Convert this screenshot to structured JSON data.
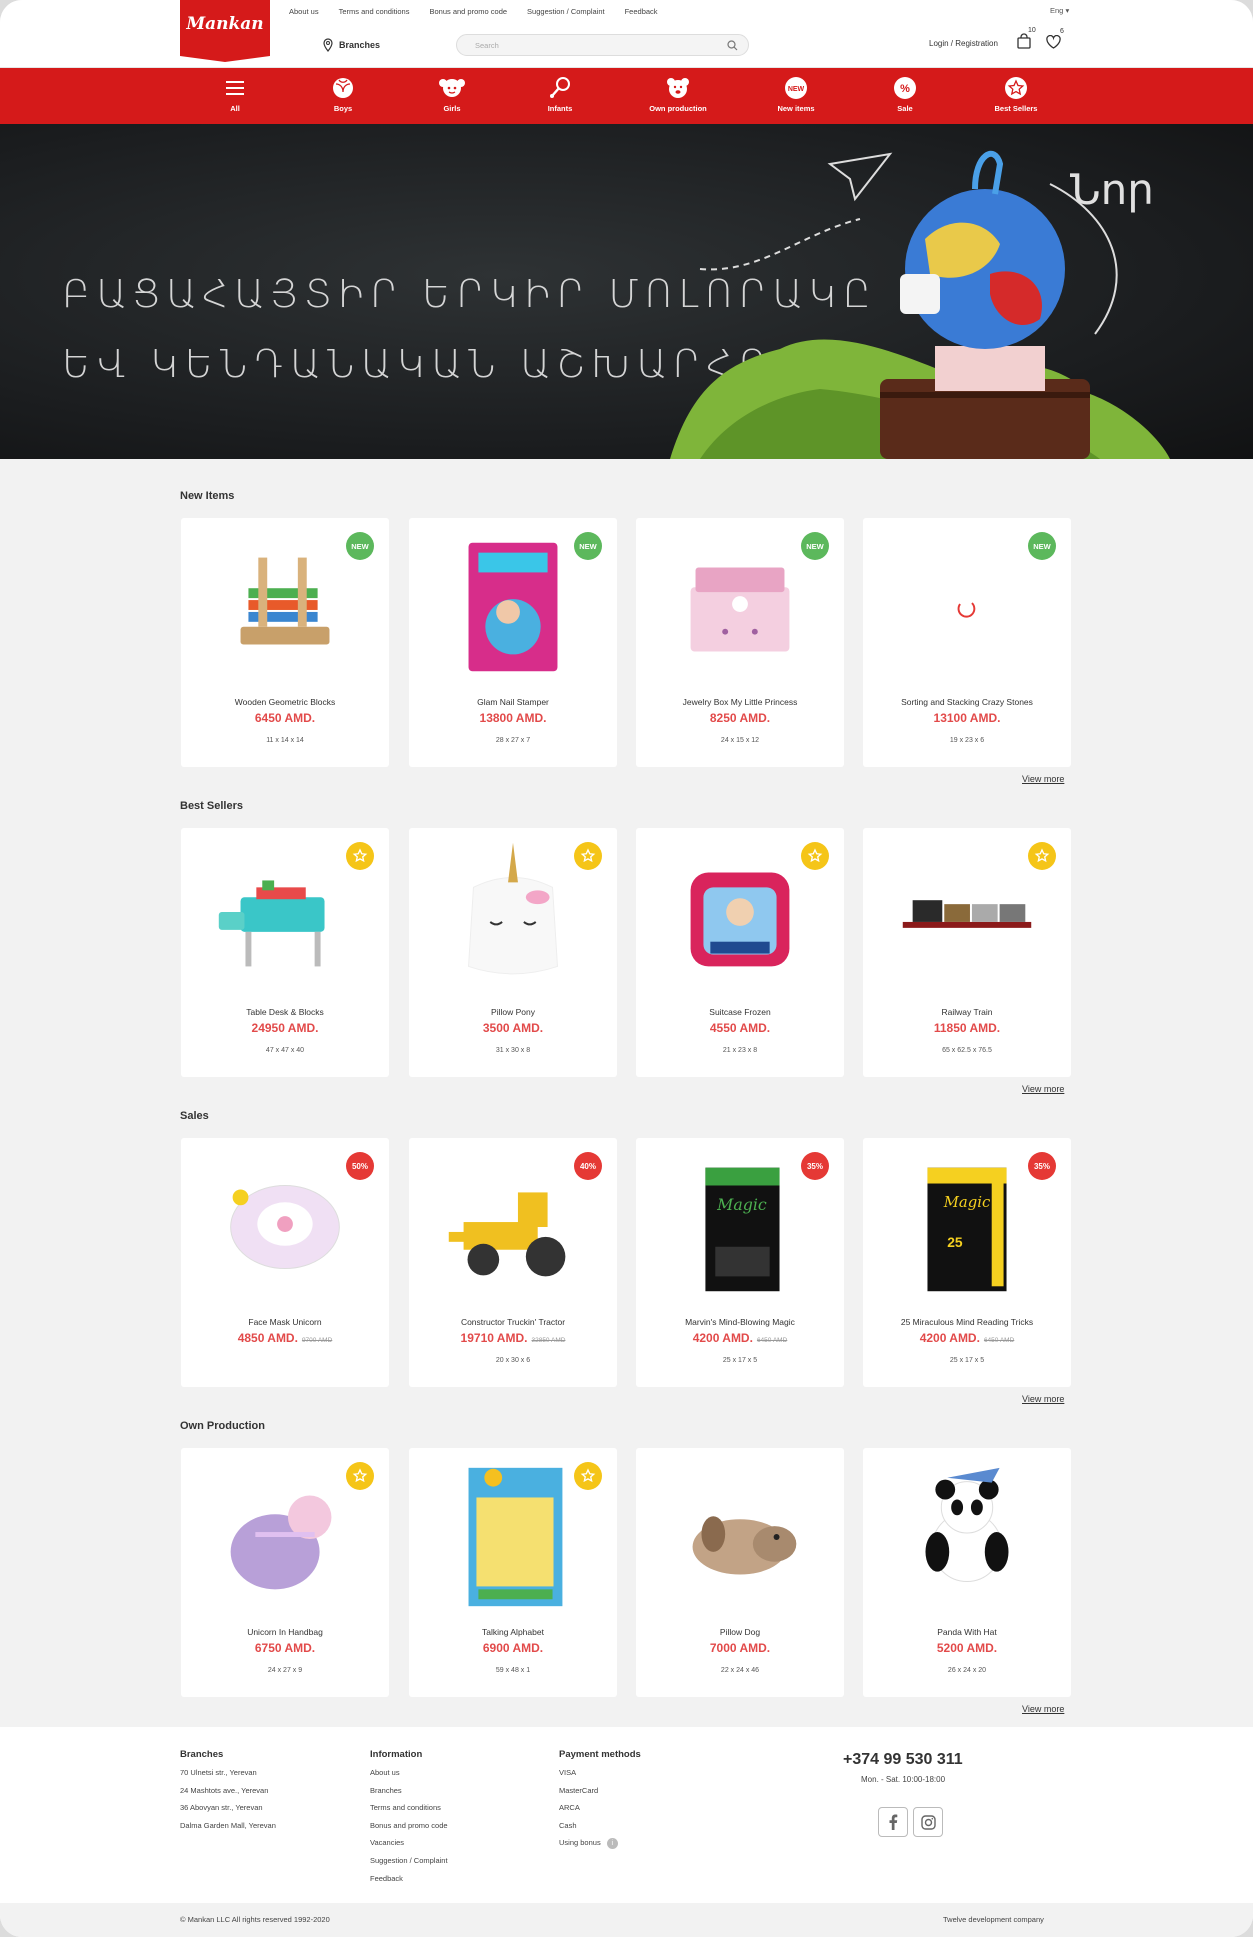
{
  "header": {
    "logo_text": "Mankan",
    "top_links": [
      "About us",
      "Terms and conditions",
      "Bonus and promo code",
      "Suggestion / Complaint",
      "Feedback"
    ],
    "language": "Eng",
    "branches_label": "Branches",
    "search_placeholder": "Search",
    "login_label": "Login / Registration",
    "cart_count": "10",
    "favorites_count": "6"
  },
  "nav": {
    "items": [
      {
        "label": "All",
        "icon": "menu-icon"
      },
      {
        "label": "Boys",
        "icon": "ball-icon"
      },
      {
        "label": "Girls",
        "icon": "doll-icon"
      },
      {
        "label": "Infants",
        "icon": "rattle-icon"
      },
      {
        "label": "Own production",
        "icon": "bear-icon"
      },
      {
        "label": "New items",
        "icon": "new-icon"
      },
      {
        "label": "Sale",
        "icon": "percent-icon"
      },
      {
        "label": "Best Sellers",
        "icon": "star-icon"
      }
    ],
    "accent": "#d51a1a"
  },
  "hero": {
    "line1": "ԲԱՑԱՀԱՅՏԻՐ ԵՐԿԻՐ ՄՈԼՈՐԱԿԸ",
    "line2": "ԵՎ ԿԵՆԴԱՆԱԿԱՆ ԱՇԽԱՐՀԸ",
    "scribble": "Նոր"
  },
  "sections": [
    {
      "title": "New Items",
      "view_more": "View more",
      "badge_type": "new",
      "products": [
        {
          "name": "Wooden Geometric Blocks",
          "price": "6450 AMD.",
          "old_price": "",
          "dims": "11 x 14 x 14",
          "badge": "NEW"
        },
        {
          "name": "Glam Nail Stamper",
          "price": "13800 AMD.",
          "old_price": "",
          "dims": "28 x 27 x 7",
          "badge": "NEW"
        },
        {
          "name": "Jewelry Box My Little Princess",
          "price": "8250 AMD.",
          "old_price": "",
          "dims": "24 x 15 x 12",
          "badge": "NEW"
        },
        {
          "name": "Sorting and Stacking Crazy Stones",
          "price": "13100 AMD.",
          "old_price": "",
          "dims": "19 x 23 x 6",
          "badge": "NEW"
        }
      ]
    },
    {
      "title": "Best Sellers",
      "view_more": "View more",
      "badge_type": "star",
      "products": [
        {
          "name": "Table Desk & Blocks",
          "price": "24950 AMD.",
          "old_price": "",
          "dims": "47 x 47 x 40",
          "badge": ""
        },
        {
          "name": "Pillow Pony",
          "price": "3500 AMD.",
          "old_price": "",
          "dims": "31 x 30 x 8",
          "badge": ""
        },
        {
          "name": "Suitcase Frozen",
          "price": "4550 AMD.",
          "old_price": "",
          "dims": "21 x 23 x 8",
          "badge": ""
        },
        {
          "name": "Railway Train",
          "price": "11850 AMD.",
          "old_price": "",
          "dims": "65 x 62.5 x 76.5",
          "badge": ""
        }
      ]
    },
    {
      "title": "Sales",
      "view_more": "View more",
      "badge_type": "sale",
      "products": [
        {
          "name": "Face Mask Unicorn",
          "price": "4850 AMD.",
          "old_price": "9700 AMD",
          "dims": "",
          "badge": "50%"
        },
        {
          "name": "Constructor Truckin' Tractor",
          "price": "19710 AMD.",
          "old_price": "32850 AMD",
          "dims": "20 x 30 x 6",
          "badge": "40%"
        },
        {
          "name": "Marvin's Mind-Blowing Magic",
          "price": "4200 AMD.",
          "old_price": "6450 AMD",
          "dims": "25 x 17 x 5",
          "badge": "35%"
        },
        {
          "name": "25 Miraculous Mind Reading Tricks",
          "price": "4200 AMD.",
          "old_price": "6450 AMD",
          "dims": "25 x 17 x 5",
          "badge": "35%"
        }
      ]
    },
    {
      "title": "Own Production",
      "view_more": "View more",
      "badge_type": "star",
      "products": [
        {
          "name": "Unicorn In Handbag",
          "price": "6750 AMD.",
          "old_price": "",
          "dims": "24 x 27 x 9",
          "badge": ""
        },
        {
          "name": "Talking Alphabet",
          "price": "6900 AMD.",
          "old_price": "",
          "dims": "59 x 48 x 1",
          "badge": ""
        },
        {
          "name": "Pillow Dog",
          "price": "7000 AMD.",
          "old_price": "",
          "dims": "22 x 24 x 46",
          "badge": ""
        },
        {
          "name": "Panda With Hat",
          "price": "5200 AMD.",
          "old_price": "",
          "dims": "26 x 24 x 20",
          "badge": ""
        }
      ]
    }
  ],
  "footer": {
    "branches": {
      "title": "Branches",
      "items": [
        "70 Ulnetsi str., Yerevan",
        "24 Mashtots ave., Yerevan",
        "36 Abovyan str., Yerevan",
        "Dalma Garden Mall, Yerevan"
      ]
    },
    "information": {
      "title": "Information",
      "items": [
        "About us",
        "Branches",
        "Terms and conditions",
        "Bonus and promo code",
        "Vacancies",
        "Suggestion / Complaint",
        "Feedback"
      ]
    },
    "payment": {
      "title": "Payment methods",
      "items": [
        "VISA",
        "MasterCard",
        "ARCA",
        "Cash",
        "Using bonus"
      ]
    },
    "phone": "+374 99 530 311",
    "hours": "Mon. - Sat. 10:00-18:00",
    "copyright": "© Mankan LLC All rights reserved 1992-2020",
    "developer": "Twelve development company"
  }
}
